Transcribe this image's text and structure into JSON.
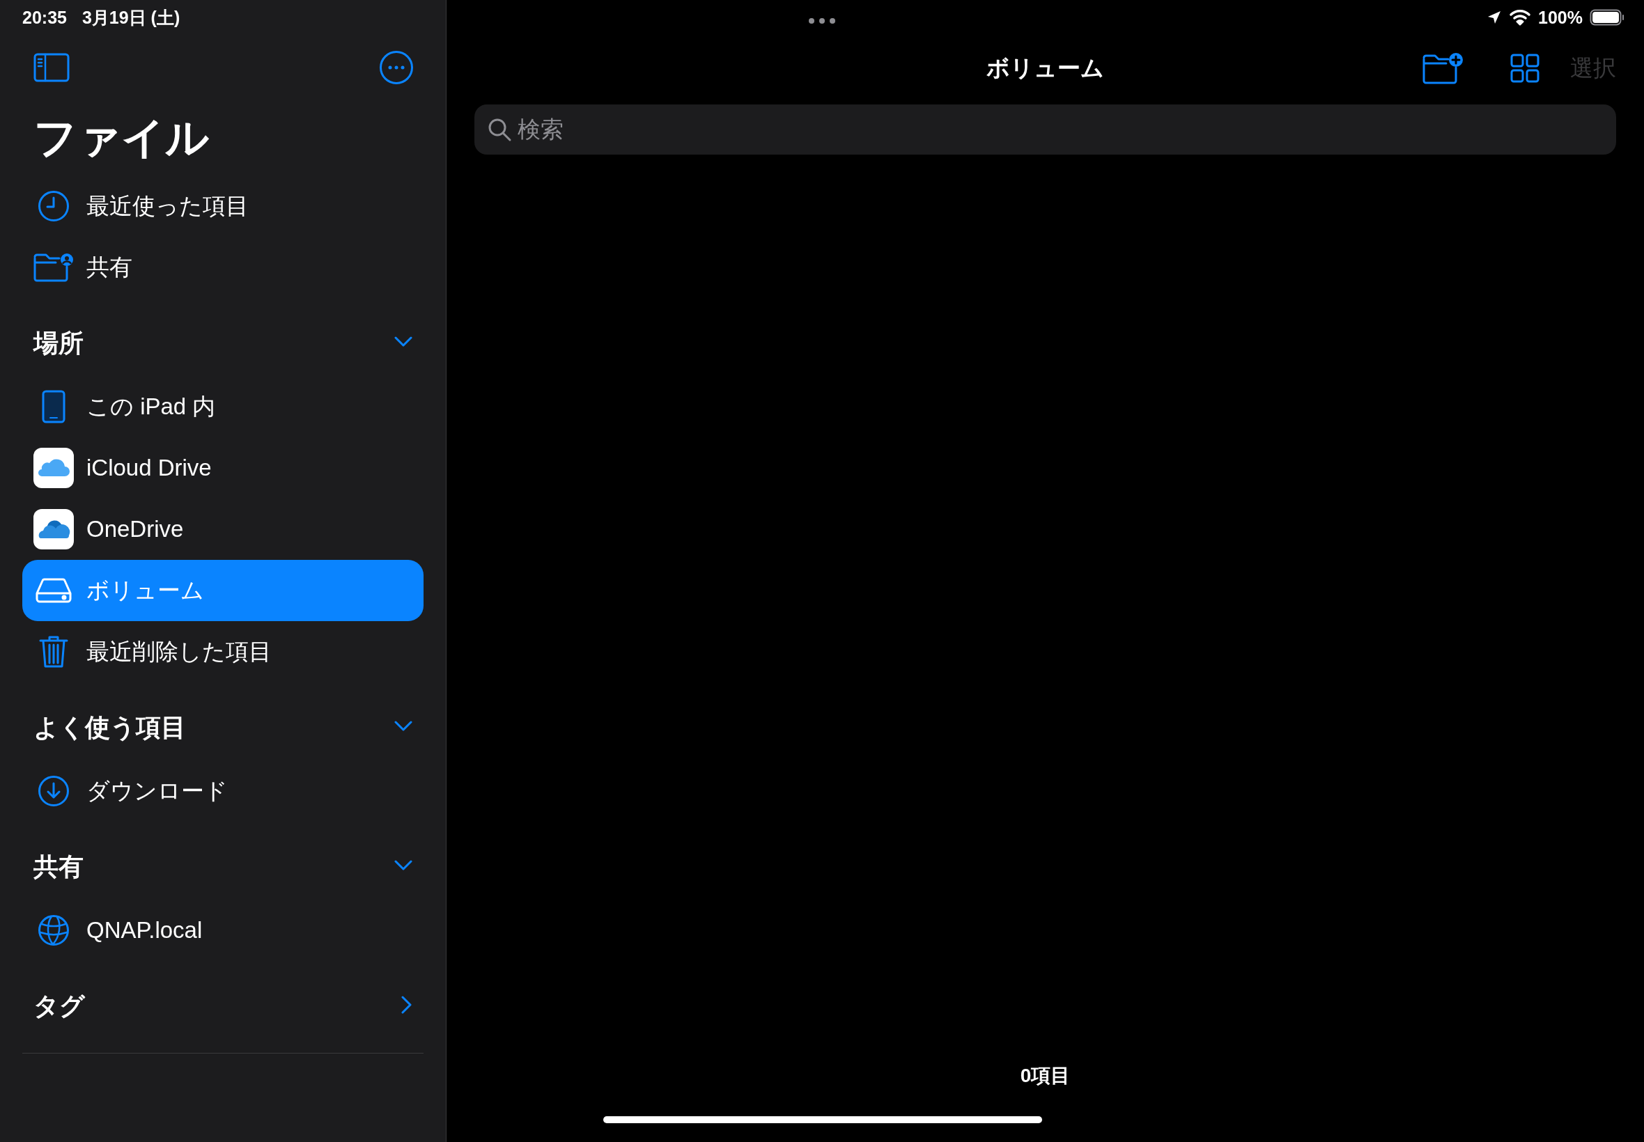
{
  "status_bar": {
    "time": "20:35",
    "date": "3月19日 (土)",
    "battery": "100%"
  },
  "sidebar": {
    "title": "ファイル",
    "sections": [
      {
        "items": [
          {
            "label": "最近使った項目",
            "kind": "recents",
            "selected": false
          },
          {
            "label": "共有",
            "kind": "shared",
            "selected": false
          }
        ]
      },
      {
        "title": "場所",
        "expanded": true,
        "items": [
          {
            "label": "この iPad 内",
            "kind": "device",
            "selected": false
          },
          {
            "label": "iCloud Drive",
            "kind": "icloud",
            "selected": false
          },
          {
            "label": "OneDrive",
            "kind": "onedrive",
            "selected": false
          },
          {
            "label": "ボリューム",
            "kind": "volume",
            "selected": true
          },
          {
            "label": "最近削除した項目",
            "kind": "trash",
            "selected": false
          }
        ]
      },
      {
        "title": "よく使う項目",
        "expanded": true,
        "items": [
          {
            "label": "ダウンロード",
            "kind": "download",
            "selected": false
          }
        ]
      },
      {
        "title": "共有",
        "expanded": true,
        "items": [
          {
            "label": "QNAP.local",
            "kind": "server",
            "selected": false
          }
        ]
      },
      {
        "title": "タグ",
        "expanded": false
      }
    ]
  },
  "main": {
    "title": "ボリューム",
    "search": {
      "placeholder": "検索"
    },
    "select_button": {
      "label": "選択",
      "disabled": true
    },
    "item_count": "0項目"
  }
}
